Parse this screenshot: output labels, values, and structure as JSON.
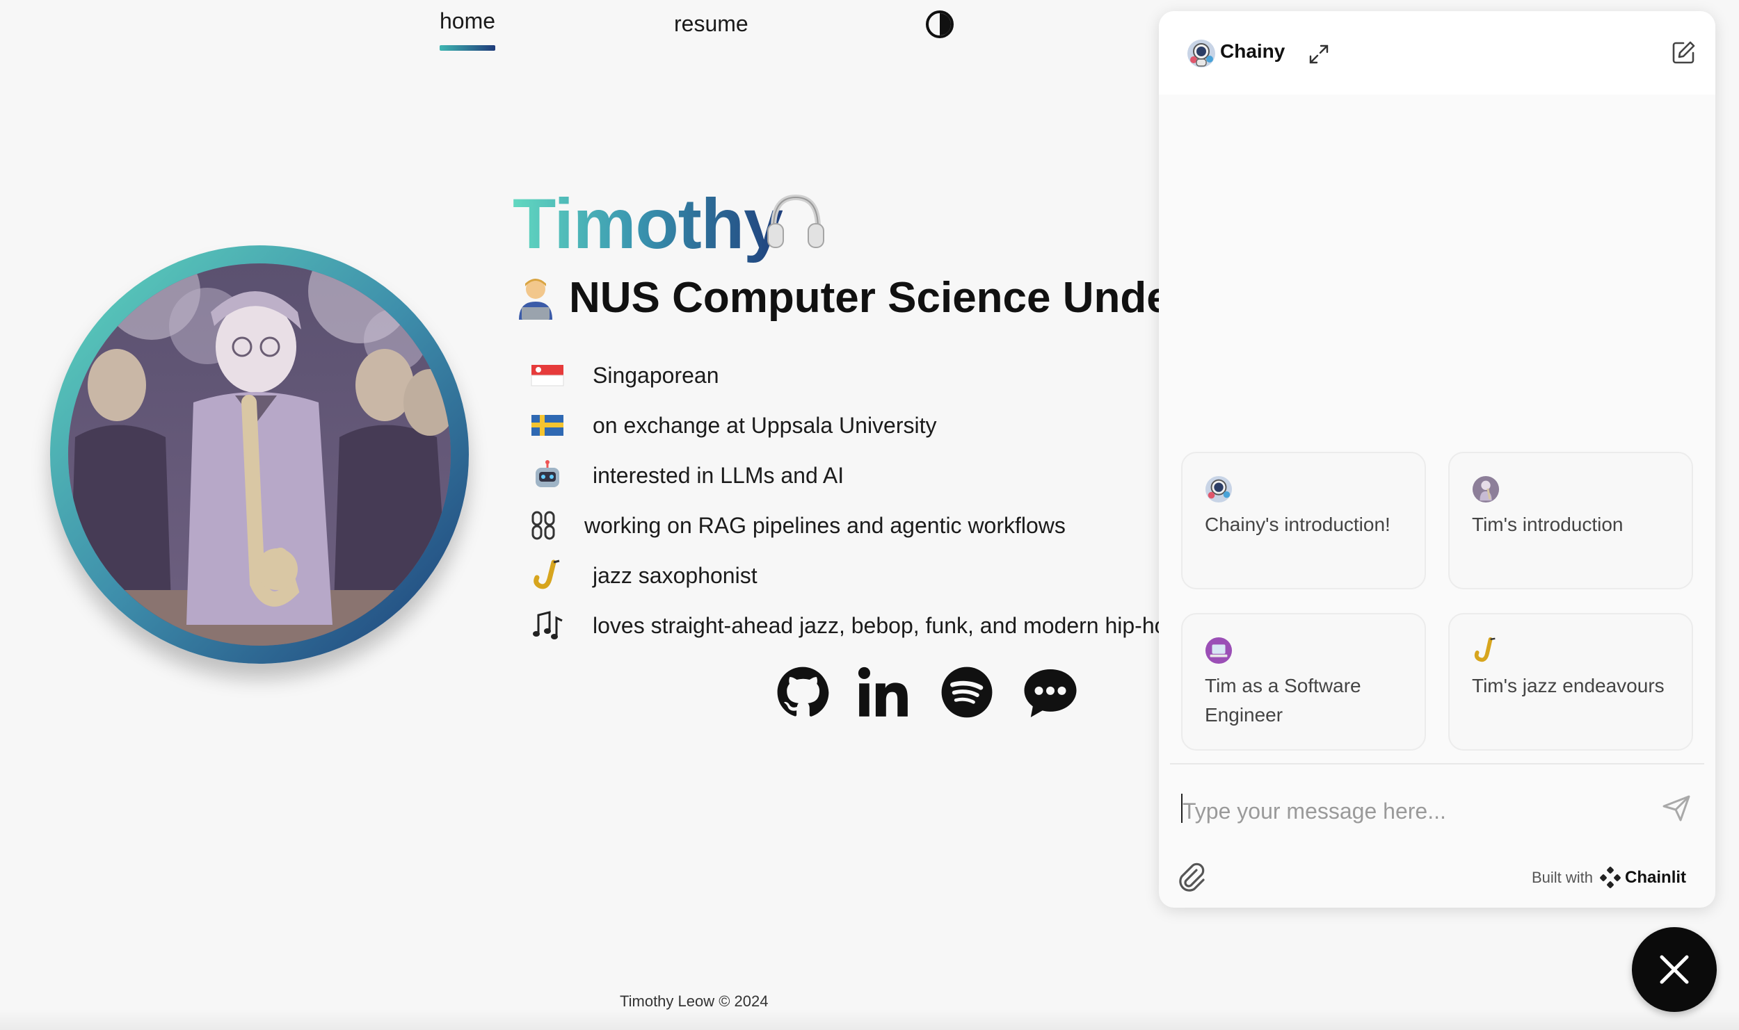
{
  "nav": {
    "home_label": "home",
    "resume_label": "resume",
    "theme_toggle_icon": "contrast-icon"
  },
  "profile": {
    "name": "Timothy",
    "name_emoji_icon": "headphones-icon",
    "subtitle_emoji_icon": "technologist-icon",
    "subtitle": "NUS Computer Science Undergraduate",
    "facts": [
      {
        "icon": "singapore-flag-icon",
        "text": "Singaporean"
      },
      {
        "icon": "sweden-flag-icon",
        "text": "on exchange at Uppsala University"
      },
      {
        "icon": "robot-icon",
        "text": "interested in LLMs and AI"
      },
      {
        "icon": "link-icon",
        "text": "working on RAG pipelines and agentic workflows"
      },
      {
        "icon": "saxophone-icon",
        "text": "jazz saxophonist"
      },
      {
        "icon": "music-notes-icon",
        "text": "loves straight-ahead jazz, bebop, funk, and modern hip-hop"
      }
    ],
    "socials": [
      "github-icon",
      "linkedin-icon",
      "spotify-icon",
      "chat-bubble-icon"
    ]
  },
  "footer": {
    "text": "Timothy Leow © 2024"
  },
  "chat": {
    "title": "Chainy",
    "starters": [
      {
        "icon": "astronaut-avatar-icon",
        "label": "Chainy's introduction!"
      },
      {
        "icon": "tim-avatar-icon",
        "label": "Tim's introduction"
      },
      {
        "icon": "laptop-icon",
        "label": "Tim as a Software Engineer"
      },
      {
        "icon": "saxophone-icon",
        "label": "Tim's jazz endeavours"
      }
    ],
    "input_placeholder": "Type your message here...",
    "built_with_label": "Built with",
    "brand": "Chainlit"
  },
  "colors": {
    "accent_start": "#62d8c0",
    "accent_end": "#1f3f7c",
    "fab": "#0b0b0b"
  }
}
